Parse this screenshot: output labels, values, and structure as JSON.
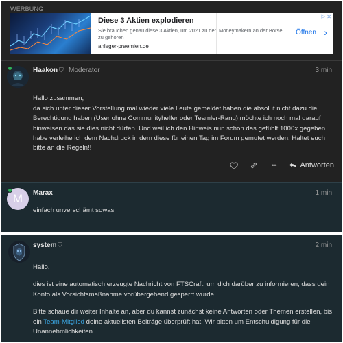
{
  "ad": {
    "label": "WERBUNG",
    "title": "Diese 3 Aktien explodieren",
    "description": "Sie brauchen genau diese 3 Aktien, um 2021 zu den Moneymakern an der Börse zu gehören",
    "domain": "anleger-praemien.de",
    "cta": "Öffnen",
    "chevron": "›"
  },
  "posts": [
    {
      "username": "Haakon",
      "role": "Moderator",
      "time": "3 min",
      "paragraphs": [
        "Hallo zusammen,\nda sich unter dieser Vorstellung mal wieder viele Leute gemeldet haben die absolut nicht dazu die Berechtigung haben (User ohne Communityhelfer oder Teamler-Rang) möchte ich noch mal darauf hinweisen das sie dies nicht dürfen. Und weil ich den Hinweis nun schon das gefühlt 1000x gegeben habe verleihe ich dem Nachdruck in dem diese für einen Tag im Forum gemutet werden. Haltet euch bitte an die Regeln!!"
      ],
      "reply_label": "Antworten",
      "more_glyph": "•••"
    },
    {
      "username": "Marax",
      "avatar_letter": "M",
      "time": "1 min",
      "paragraphs": [
        "einfach unverschämt sowas"
      ]
    },
    {
      "username": "system",
      "time": "2 min",
      "p1": "Hallo,",
      "p2": "dies ist eine automatisch erzeugte Nachricht von FTSCraft, um dich darüber zu informieren, dass dein Konto als Vorsichtsmaßnahme vorübergehend gesperrt wurde.",
      "p3_before": "Bitte schaue dir weiter Inhalte an, aber du kannst zunächst keine Antworten oder Themen erstellen, bis ein ",
      "p3_link": "Team-Mitglied",
      "p3_after": " deine aktuellsten Beiträge überprüft hat. Wir bitten um Entschuldigung für die Unannehmlichkeiten."
    }
  ],
  "colors": {
    "background": "#222222",
    "highlight": "#1c2a30",
    "link": "#3aa5e0",
    "online": "#2fb35a",
    "ad_cta": "#1a73e8"
  },
  "icons": [
    "shield-icon",
    "heart-icon",
    "link-icon",
    "more-icon",
    "reply-arrow-icon",
    "chevron-right-icon",
    "ad-close-icon",
    "ad-info-icon"
  ]
}
